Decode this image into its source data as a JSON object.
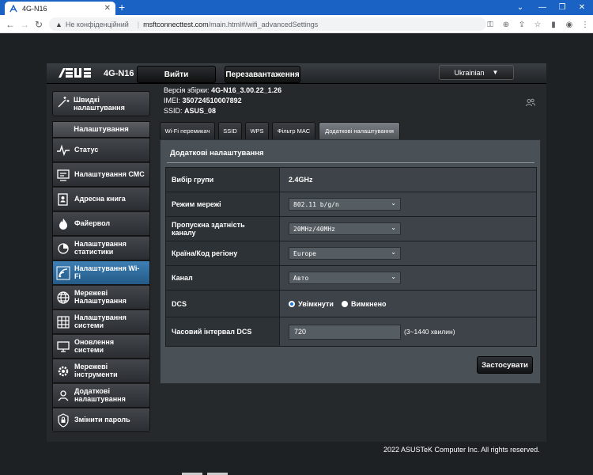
{
  "browser": {
    "tab_title": "4G-N16",
    "new_tab": "+",
    "security": "Не конфіденційний",
    "url_host": "msftconnecttest.com",
    "url_path": "/main.html#/wifi_advancedSettings"
  },
  "header": {
    "brand": "/ISUS",
    "model": "4G-N16",
    "logout": "Вийти",
    "reboot": "Перезавантаження",
    "language": "Ukrainian"
  },
  "info": {
    "firmware_label": "Версія збірки:",
    "firmware_value": "4G-N16_3.00.22_1.26",
    "imei_label": "IMEI:",
    "imei_value": "350724510007892",
    "ssid_label": "SSID:",
    "ssid_value": "ASUS_08"
  },
  "quick_setup": {
    "line1": "Швидкі",
    "line2": "налаштування"
  },
  "sidebar": {
    "heading": "Налаштування",
    "items": [
      {
        "line1": "Статус",
        "line2": ""
      },
      {
        "line1": "Налаштування СМС",
        "line2": ""
      },
      {
        "line1": "Адресна книга",
        "line2": ""
      },
      {
        "line1": "Файервол",
        "line2": ""
      },
      {
        "line1": "Налаштування",
        "line2": "статистики"
      },
      {
        "line1": "Налаштування Wi-",
        "line2": "Fi"
      },
      {
        "line1": "Мережеві",
        "line2": "Налаштування"
      },
      {
        "line1": "Налаштування",
        "line2": "системи"
      },
      {
        "line1": "Оновлення",
        "line2": "системи"
      },
      {
        "line1": "Мережеві",
        "line2": "інструменти"
      },
      {
        "line1": "Додаткові",
        "line2": "налаштування"
      },
      {
        "line1": "Змінити пароль",
        "line2": ""
      }
    ],
    "active_index": 5
  },
  "tabs": [
    "Wi-Fi перемикач",
    "SSID",
    "WPS",
    "Фільтр МАС",
    "Додаткові налаштування"
  ],
  "active_tab": 4,
  "panel": {
    "title": "Додаткові налаштування",
    "rows": {
      "group_label": "Вибір групи",
      "group_value": "2.4GHz",
      "mode_label": "Режим мережі",
      "mode_value": "802.11 b/g/n",
      "bandwidth_label1": "Пропускна здатність",
      "bandwidth_label2": "каналу",
      "bandwidth_value": "20MHz/40MHz",
      "region_label": "Країна/Код регіону",
      "region_value": "Europe",
      "channel_label": "Канал",
      "channel_value": "Авто",
      "dcs_label": "DCS",
      "dcs_on": "Увімкнути",
      "dcs_off": "Вимкнено",
      "dcs_selected": "on",
      "interval_label": "Часовий інтервал DCS",
      "interval_value": "720",
      "interval_hint": "(3~1440 хвилин)"
    },
    "apply": "Застосувати"
  },
  "footer": "2022 ASUSTeK Computer Inc. All rights reserved.",
  "colors": {
    "accent": "#2a6aa0",
    "chrome_tab": "#1a62c4"
  }
}
